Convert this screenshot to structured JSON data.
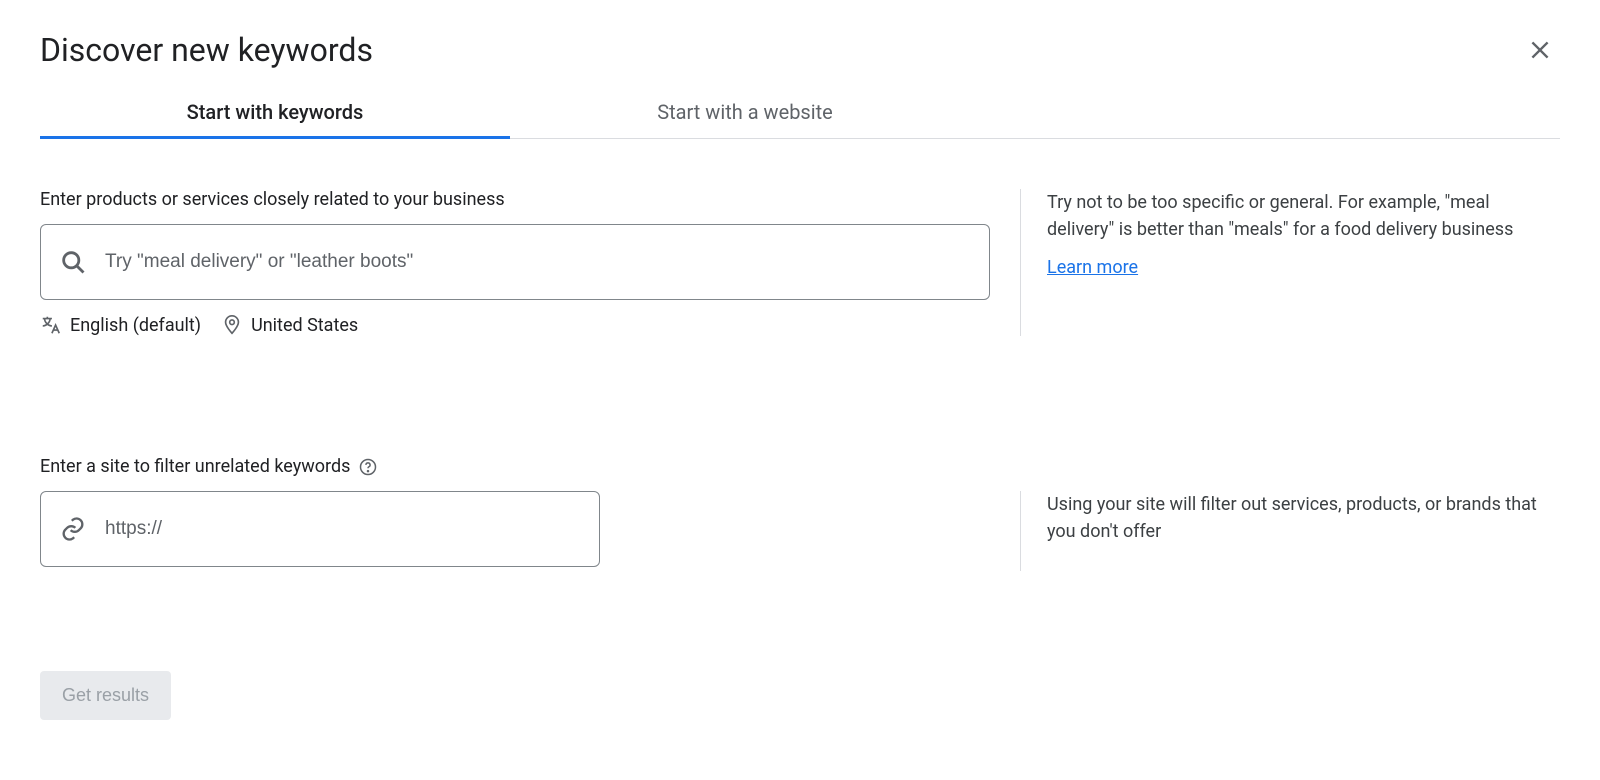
{
  "header": {
    "title": "Discover new keywords"
  },
  "tabs": {
    "keywords": "Start with keywords",
    "website": "Start with a website"
  },
  "keywords_section": {
    "label": "Enter products or services closely related to your business",
    "placeholder": "Try \"meal delivery\" or \"leather boots\"",
    "language": "English (default)",
    "location": "United States",
    "hint": "Try not to be too specific or general. For example, \"meal delivery\" is better than \"meals\" for a food delivery business",
    "learn_more": "Learn more"
  },
  "site_section": {
    "label": "Enter a site to filter unrelated keywords",
    "placeholder": "https://",
    "hint": "Using your site will filter out services, products, or brands that you don't offer"
  },
  "actions": {
    "get_results": "Get results"
  }
}
